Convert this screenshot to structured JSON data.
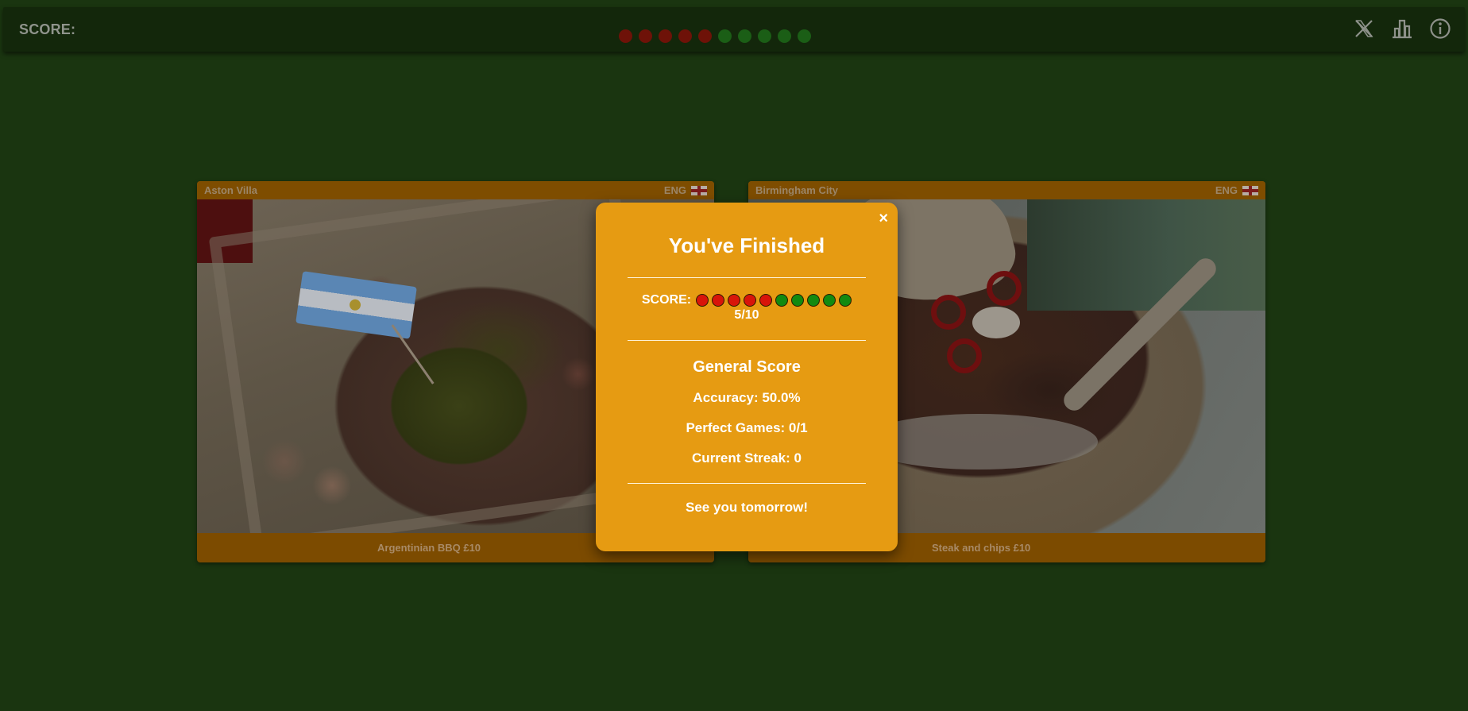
{
  "topbar": {
    "score_label": "SCORE:",
    "results": [
      "wrong",
      "wrong",
      "wrong",
      "wrong",
      "wrong",
      "correct",
      "correct",
      "correct",
      "correct",
      "correct"
    ],
    "icons": [
      "x-twitter-icon",
      "stats-icon",
      "info-icon"
    ]
  },
  "cards": [
    {
      "club": "Aston Villa",
      "country": "ENG",
      "food": "Argentinian BBQ £10"
    },
    {
      "club": "Birmingham City",
      "country": "ENG",
      "food": "Steak and chips £10"
    }
  ],
  "modal": {
    "close": "×",
    "title": "You've Finished",
    "score_label": "SCORE:",
    "results": [
      "wrong",
      "wrong",
      "wrong",
      "wrong",
      "wrong",
      "correct",
      "correct",
      "correct",
      "correct",
      "correct"
    ],
    "fraction": "5/10",
    "section_title": "General Score",
    "accuracy": "Accuracy: 50.0%",
    "perfect_games": "Perfect Games: 0/1",
    "current_streak": "Current Streak: 0",
    "farewell": "See you tomorrow!"
  },
  "colors": {
    "background": "#1a3510",
    "modal": "#e69b12",
    "wrong": "#d8150a",
    "correct": "#138a10"
  }
}
